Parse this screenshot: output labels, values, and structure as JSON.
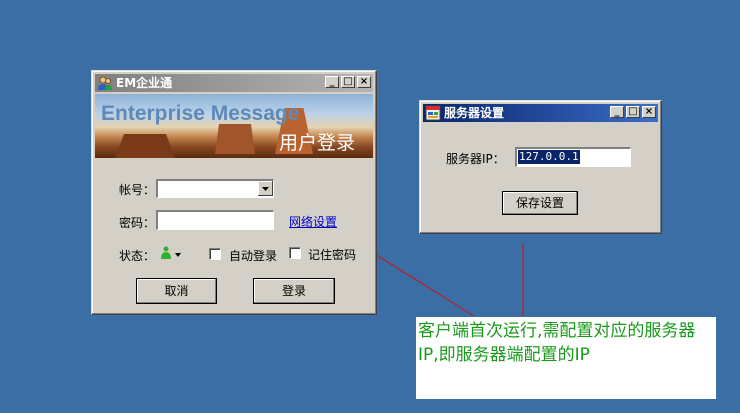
{
  "login_window": {
    "title": "EM企业通",
    "minimize": "_",
    "maximize": "□",
    "close": "×",
    "banner_title": "Enterprise Message",
    "banner_subtitle": "用户登录",
    "account_label": "帐号：",
    "account_value": "",
    "password_label": "密码：",
    "password_value": "",
    "network_settings_link": "网络设置",
    "status_label": "状态：",
    "auto_login_label": "自动登录",
    "auto_login_checked": false,
    "remember_password_label": "记住密码",
    "remember_password_checked": false,
    "cancel_button": "取消",
    "login_button": "登录"
  },
  "server_window": {
    "title": "服务器设置",
    "minimize": "_",
    "maximize": "□",
    "close": "×",
    "server_ip_label": "服务器IP：",
    "server_ip_value": "127.0.0.1",
    "save_button": "保存设置"
  },
  "annotation": {
    "text": "客户端首次运行,需配置对应的服务器IP,即服务器端配置的IP",
    "color": "#1a9a1a"
  },
  "colors": {
    "desktop": "#3a6ea5",
    "active_title": "#0a246a",
    "inactive_title": "#808080"
  }
}
